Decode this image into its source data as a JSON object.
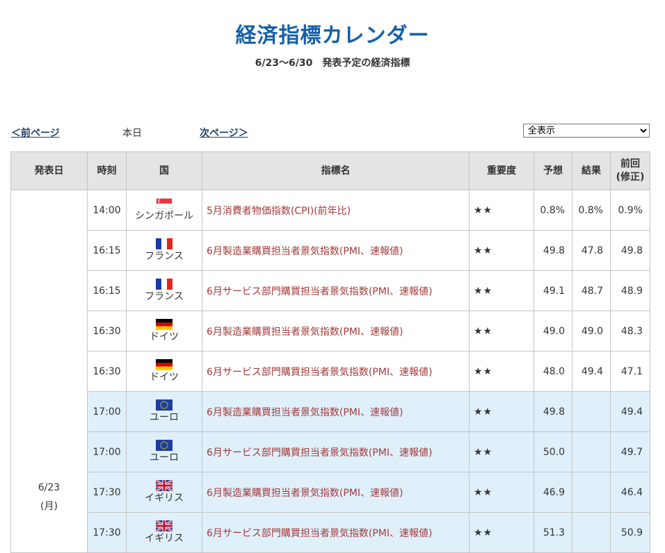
{
  "header": {
    "title": "経済指標カレンダー",
    "subtitle": "6/23〜6/30　発表予定の経済指標"
  },
  "nav": {
    "prev": "＜前ページ",
    "today": "本日",
    "next": "次ページ＞",
    "filter_selected": "全表示"
  },
  "table": {
    "headers": {
      "date": "発表日",
      "time": "時刻",
      "country": "国",
      "name": "指標名",
      "importance": "重要度",
      "forecast": "予想",
      "result": "結果",
      "previous_line1": "前回",
      "previous_line2": "(修正)"
    },
    "date": {
      "day": "6/23",
      "weekday": "(月)"
    },
    "rows": [
      {
        "time": "14:00",
        "flag": "singapore-flag",
        "country": "シンガポール",
        "name": "5月消費者物価指数(CPI)(前年比)",
        "importance": "★★",
        "forecast": "0.8%",
        "result": "0.8%",
        "previous": "0.9%"
      },
      {
        "time": "16:15",
        "flag": "france-flag",
        "country": "フランス",
        "name": "6月製造業購買担当者景気指数(PMI、速報値)",
        "importance": "★★",
        "forecast": "49.8",
        "result": "47.8",
        "previous": "49.8"
      },
      {
        "time": "16:15",
        "flag": "france-flag",
        "country": "フランス",
        "name": "6月サービス部門購買担当者景気指数(PMI、速報値)",
        "importance": "★★",
        "forecast": "49.1",
        "result": "48.7",
        "previous": "48.9"
      },
      {
        "time": "16:30",
        "flag": "germany-flag",
        "country": "ドイツ",
        "name": "6月製造業購買担当者景気指数(PMI、速報値)",
        "importance": "★★",
        "forecast": "49.0",
        "result": "49.0",
        "previous": "48.3"
      },
      {
        "time": "16:30",
        "flag": "germany-flag",
        "country": "ドイツ",
        "name": "6月サービス部門購買担当者景気指数(PMI、速報値)",
        "importance": "★★",
        "forecast": "48.0",
        "result": "49.4",
        "previous": "47.1"
      },
      {
        "time": "17:00",
        "flag": "eu-flag",
        "country": "ユーロ",
        "name": "6月製造業購買担当者景気指数(PMI、速報値)",
        "importance": "★★",
        "forecast": "49.8",
        "result": "",
        "previous": "49.4"
      },
      {
        "time": "17:00",
        "flag": "eu-flag",
        "country": "ユーロ",
        "name": "6月サービス部門購買担当者景気指数(PMI、速報値)",
        "importance": "★★",
        "forecast": "50.0",
        "result": "",
        "previous": "49.7"
      },
      {
        "time": "17:30",
        "flag": "uk-flag",
        "country": "イギリス",
        "name": "6月製造業購買担当者景気指数(PMI、速報値)",
        "importance": "★★",
        "forecast": "46.9",
        "result": "",
        "previous": "46.4"
      },
      {
        "time": "17:30",
        "flag": "uk-flag",
        "country": "イギリス",
        "name": "6月サービス部門購買担当者景気指数(PMI、速報値)",
        "importance": "★★",
        "forecast": "51.3",
        "result": "",
        "previous": "50.9"
      }
    ]
  },
  "colors": {
    "title": "#1560a8",
    "indicator_link": "#a33a3a",
    "highlight_row": "#dff0fb",
    "header_bg": "#e4e4e4"
  }
}
